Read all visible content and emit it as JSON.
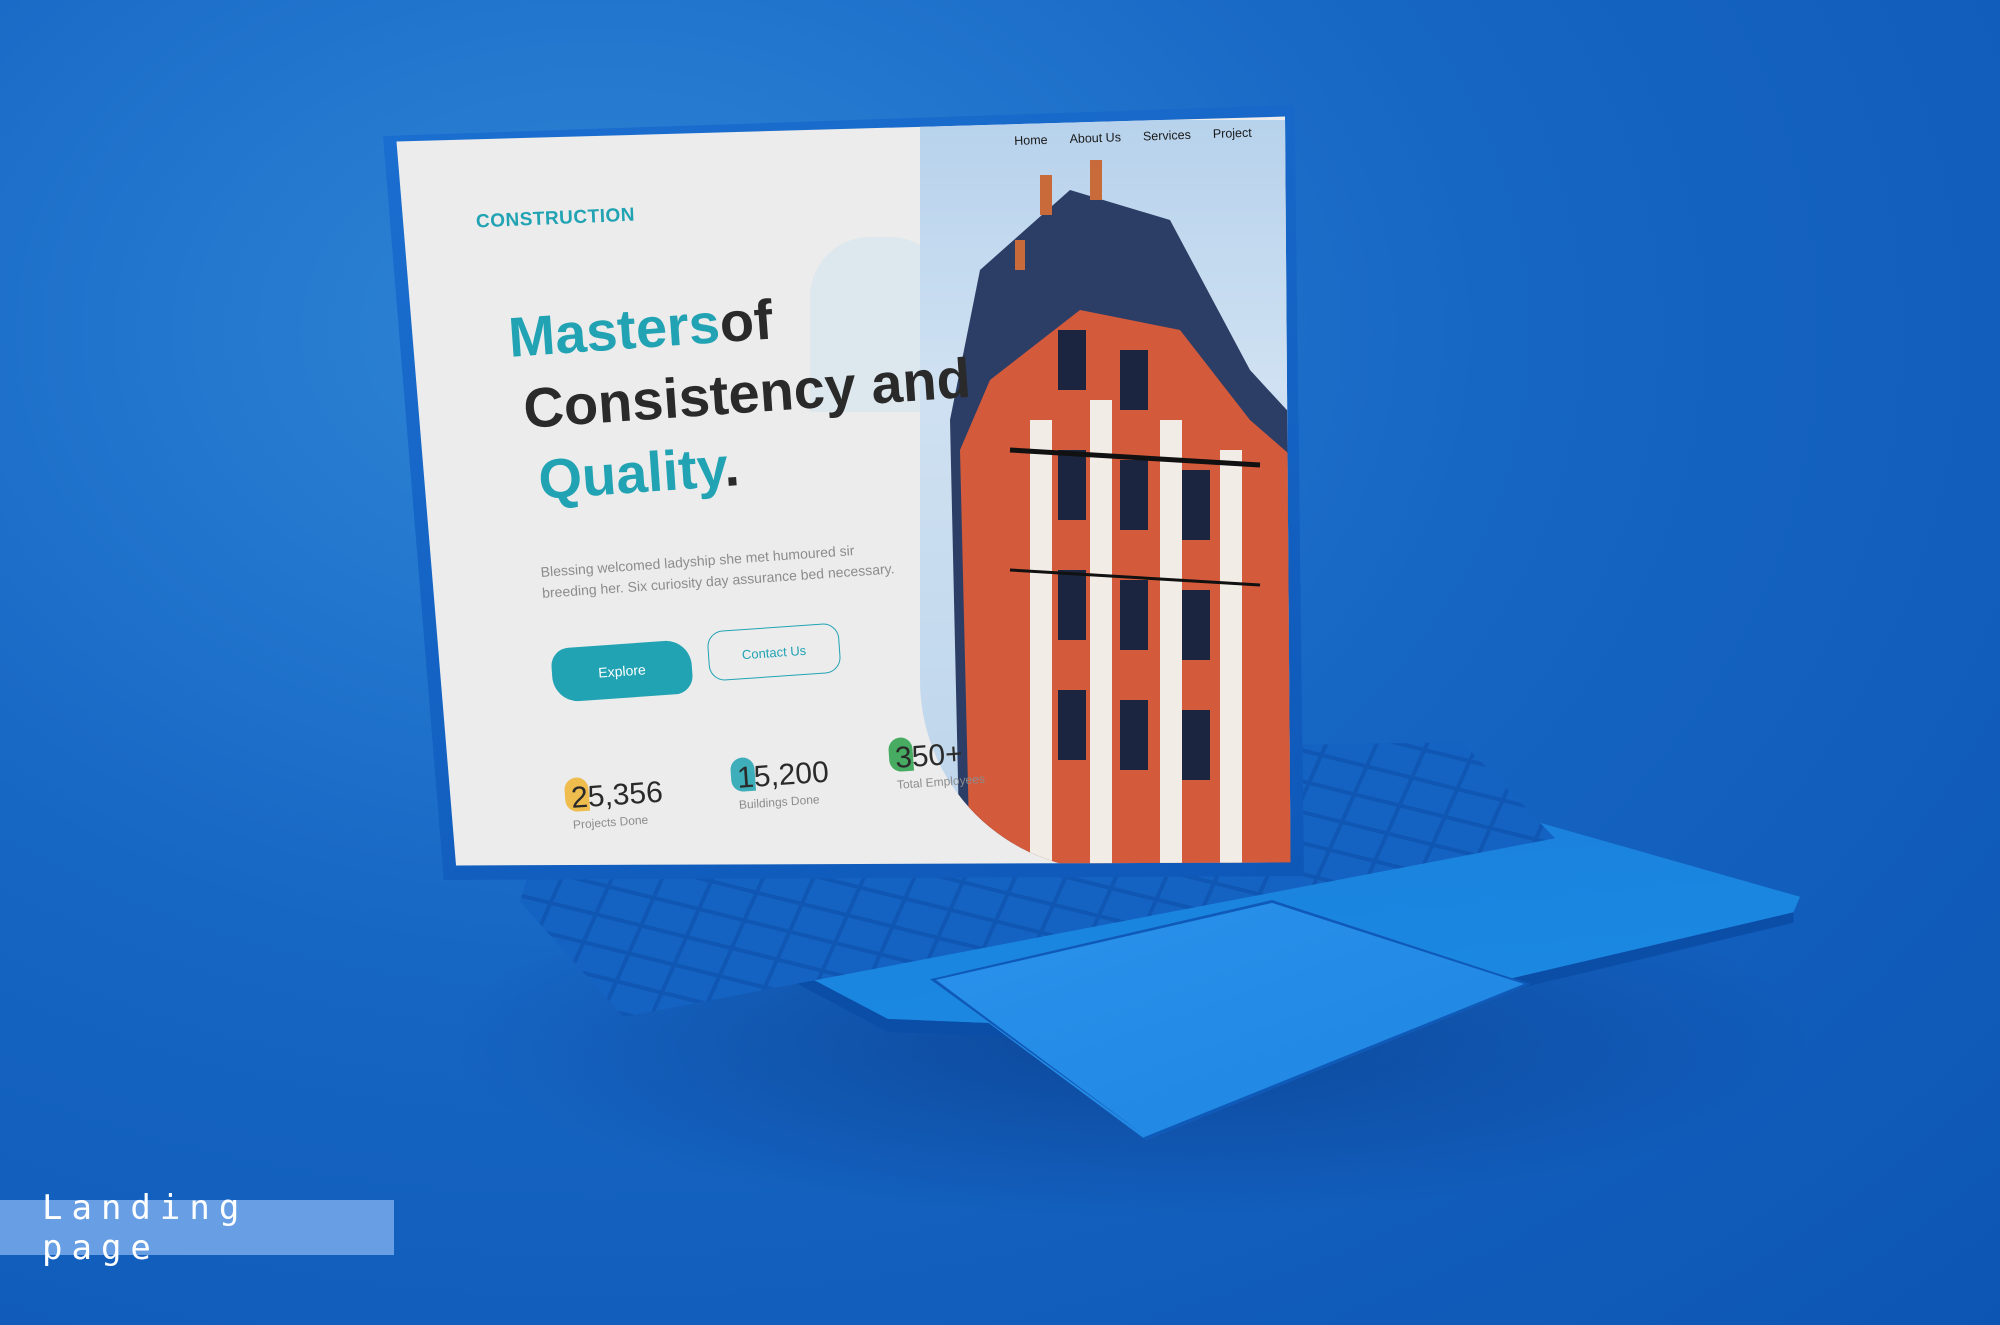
{
  "screen": {
    "logo": "CONSTRUCTION",
    "nav": [
      "Home",
      "About Us",
      "Services",
      "Project"
    ],
    "headline": {
      "part1_accent": "Masters",
      "part1_rest": "of",
      "line2": "Consistency and",
      "line3_accent": "Quality",
      "line3_rest": "."
    },
    "subtext": "Blessing welcomed ladyship she met humoured sir breeding her. Six curiosity day assurance bed necessary.",
    "buttons": {
      "explore": "Explore",
      "contact": "Contact Us"
    },
    "stats": [
      {
        "value": "25,356",
        "label": "Projects Done"
      },
      {
        "value": "15,200",
        "label": "Buildings Done"
      },
      {
        "value": "350+",
        "label": "Total Employees"
      }
    ]
  },
  "badge": "Landing page",
  "colors": {
    "accent": "#21a3b3",
    "background": "#1666c4",
    "laptop": "#1a86e0"
  }
}
